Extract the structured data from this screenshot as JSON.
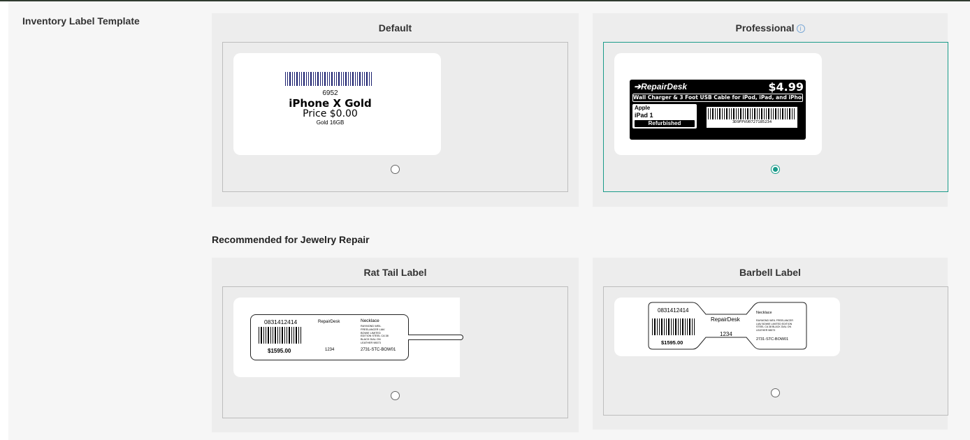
{
  "section_label": "Inventory Label Template",
  "cards": {
    "default": {
      "title": "Default",
      "selected": false,
      "label": {
        "code": "6952",
        "name": "iPhone X Gold",
        "price": "Price $0.00",
        "variant": "Gold 16GB"
      }
    },
    "professional": {
      "title": "Professional",
      "info_icon": "info-icon",
      "selected": true,
      "label": {
        "brand": "RepairDesk",
        "price": "$4.99",
        "description": "Wall Charger & 3 Foot USB Cable for iPod, iPad, and iPhone",
        "manufacturer": "Apple",
        "model": "iPad 1",
        "condition": "Refurbished",
        "barcode_text": "3D9FPVU0727185234"
      }
    },
    "rat_tail": {
      "title": "Rat Tail Label",
      "selected": false,
      "label": {
        "code": "0831412414",
        "price": "$1595.00",
        "brand": "RepairDesk",
        "number": "1234",
        "item": "Necklace",
        "desc_lines": [
          "RAYMOND WEIL",
          "FREELANCER LIAV",
          "BOWIE LIMITED",
          "EDITION STEEL CA 38",
          "BLACK DIAL ON",
          "LEATHER 98573"
        ],
        "sku": "2731-STC-BOW01"
      }
    },
    "barbell": {
      "title": "Barbell Label",
      "selected": false,
      "label": {
        "code": "0831412414",
        "price": "$1595.00",
        "brand": "RepairDesk",
        "number": "1234",
        "item": "Necklace",
        "desc_lines": [
          "RAYMOND WEIL FREELANCER",
          "LIAV BOWIE LIMITED EDITION",
          "STEEL CA 38 BLACK DIAL ON",
          "LEATHER 98573"
        ],
        "sku": "2731-STC-BOW01"
      }
    }
  },
  "jewelry_heading": "Recommended for Jewelry Repair",
  "colors": {
    "accent": "#1a9b8a",
    "card_bg": "#ededed",
    "section_bg": "#f6f6f6",
    "barcode_blue": "#1a1f6e"
  }
}
